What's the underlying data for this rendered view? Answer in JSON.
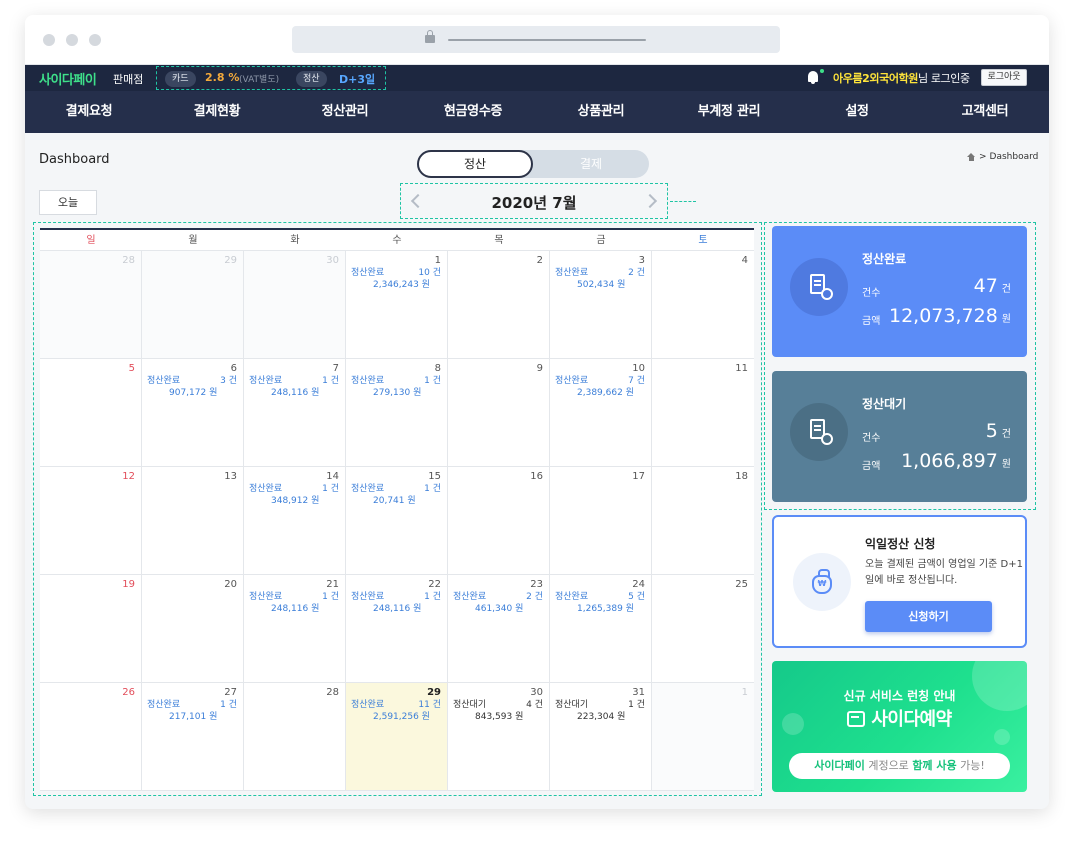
{
  "header": {
    "logo": "사이다페이",
    "logo_sub": "판매점",
    "card_label": "카드",
    "card_rate": "2.8 %",
    "vat_note": "(VAT별도)",
    "settle_label": "정산",
    "settle_cycle": "D+3일",
    "user_name": "아우름2외국어학원",
    "user_suffix": "님 로그인중",
    "logout_label": "로그아웃"
  },
  "menu": [
    "결제요청",
    "결제현황",
    "정산관리",
    "현금영수증",
    "상품관리",
    "부계정 관리",
    "설정",
    "고객센터"
  ],
  "page": {
    "title": "Dashboard",
    "breadcrumb": "Dashboard",
    "toggle_on": "정산",
    "toggle_off": "결제",
    "today_label": "오늘",
    "month_label": "2020년 7월"
  },
  "calendar": {
    "weekdays": [
      "일",
      "월",
      "화",
      "수",
      "목",
      "금",
      "토"
    ],
    "cells": [
      {
        "day": "28",
        "out": true
      },
      {
        "day": "29",
        "out": true
      },
      {
        "day": "30",
        "out": true
      },
      {
        "day": "1",
        "status": "정산완료",
        "count": "10 건",
        "amount": "2,346,243 원"
      },
      {
        "day": "2"
      },
      {
        "day": "3",
        "status": "정산완료",
        "count": "2 건",
        "amount": "502,434 원"
      },
      {
        "day": "4"
      },
      {
        "day": "5"
      },
      {
        "day": "6",
        "status": "정산완료",
        "count": "3 건",
        "amount": "907,172 원"
      },
      {
        "day": "7",
        "status": "정산완료",
        "count": "1 건",
        "amount": "248,116 원"
      },
      {
        "day": "8",
        "status": "정산완료",
        "count": "1 건",
        "amount": "279,130 원"
      },
      {
        "day": "9"
      },
      {
        "day": "10",
        "status": "정산완료",
        "count": "7 건",
        "amount": "2,389,662 원"
      },
      {
        "day": "11"
      },
      {
        "day": "12"
      },
      {
        "day": "13"
      },
      {
        "day": "14",
        "status": "정산완료",
        "count": "1 건",
        "amount": "348,912 원"
      },
      {
        "day": "15",
        "status": "정산완료",
        "count": "1 건",
        "amount": "20,741 원"
      },
      {
        "day": "16"
      },
      {
        "day": "17"
      },
      {
        "day": "18"
      },
      {
        "day": "19"
      },
      {
        "day": "20"
      },
      {
        "day": "21",
        "status": "정산완료",
        "count": "1 건",
        "amount": "248,116 원"
      },
      {
        "day": "22",
        "status": "정산완료",
        "count": "1 건",
        "amount": "248,116 원"
      },
      {
        "day": "23",
        "status": "정산완료",
        "count": "2 건",
        "amount": "461,340 원"
      },
      {
        "day": "24",
        "status": "정산완료",
        "count": "5 건",
        "amount": "1,265,389 원"
      },
      {
        "day": "25"
      },
      {
        "day": "26"
      },
      {
        "day": "27",
        "status": "정산완료",
        "count": "1 건",
        "amount": "217,101 원"
      },
      {
        "day": "28"
      },
      {
        "day": "29",
        "today": true,
        "status": "정산완료",
        "count": "11 건",
        "amount": "2,591,256 원"
      },
      {
        "day": "30",
        "status": "정산대기",
        "count": "4 건",
        "amount": "843,593 원"
      },
      {
        "day": "31",
        "status": "정산대기",
        "count": "1 건",
        "amount": "223,304 원"
      },
      {
        "day": "1",
        "out": true
      }
    ]
  },
  "summary": {
    "done": {
      "title": "정산완료",
      "count_label": "건수",
      "count": "47",
      "count_unit": "건",
      "amount_label": "금액",
      "amount": "12,073,728",
      "amount_unit": "원",
      "icon": "document-check-icon"
    },
    "wait": {
      "title": "정산대기",
      "count_label": "건수",
      "count": "5",
      "count_unit": "건",
      "amount_label": "금액",
      "amount": "1,066,897",
      "amount_unit": "원",
      "icon": "document-info-icon"
    }
  },
  "next_day": {
    "title": "익일정산 신청",
    "desc": "오늘 결제된 금액이 영업일 기준 D+1일에 바로 정산됩니다.",
    "button": "신청하기",
    "icon": "money-bag-icon"
  },
  "banner": {
    "title": "신규 서비스 런칭 안내",
    "brand": "사이다예약",
    "pill_brand": "사이다페이",
    "pill_a": " 계정으로 ",
    "pill_bold": "함께 사용",
    "pill_b": " 가능!"
  },
  "colors": {
    "nav_dark": "#1d2740",
    "accent_blue": "#5b8cf7",
    "accent_slate": "#577f98",
    "accent_green": "#1ee08e",
    "highlight_dashed": "#1fc4a4"
  }
}
